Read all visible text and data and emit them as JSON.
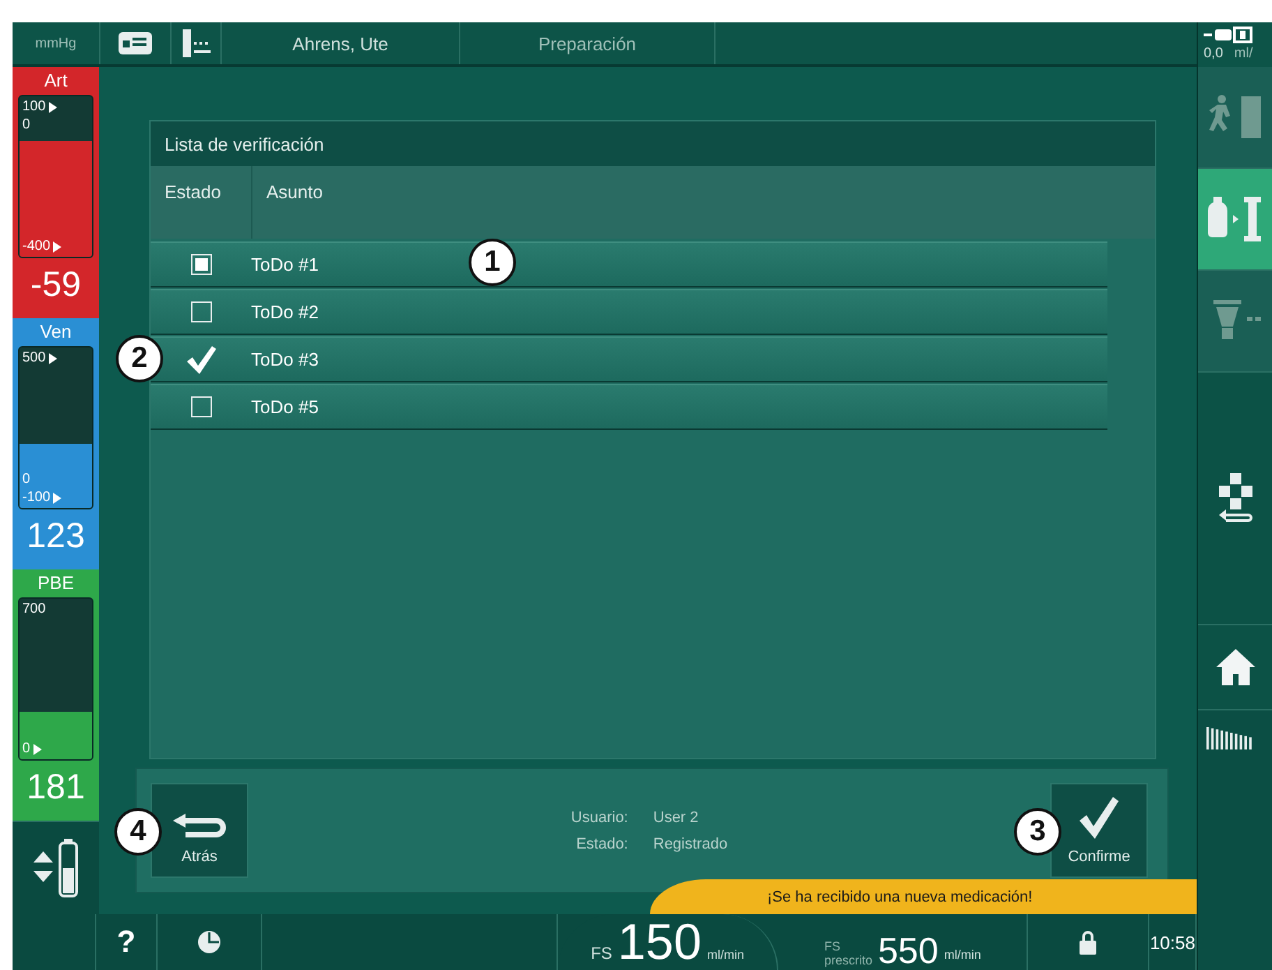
{
  "header": {
    "unit": "mmHg",
    "patient": "Ahrens, Ute",
    "phase": "Preparación",
    "syringe_rate": "0,0",
    "syringe_unit": "ml/"
  },
  "gauges": [
    {
      "label": "Art",
      "color": "#d3262a",
      "top_labels": [
        {
          "label": "100",
          "marker": true
        },
        {
          "label": "0",
          "marker": false
        }
      ],
      "bottom_labels": [
        {
          "label": "-400",
          "marker": true
        }
      ],
      "level": 0.72,
      "value": "-59"
    },
    {
      "label": "Ven",
      "color": "#2a8fd4",
      "top_labels": [
        {
          "label": "500",
          "marker": true
        }
      ],
      "bottom_labels": [
        {
          "label": "0",
          "marker": false
        },
        {
          "label": "-100",
          "marker": true
        }
      ],
      "level": 0.4,
      "value": "123"
    },
    {
      "label": "PBE",
      "color": "#2ea84a",
      "top_labels": [
        {
          "label": "700",
          "marker": false
        }
      ],
      "bottom_labels": [
        {
          "label": "0",
          "marker": true
        }
      ],
      "level": 0.3,
      "value": "181"
    }
  ],
  "checklist": {
    "title": "Lista de verificación",
    "columns": [
      "Estado",
      "Asunto"
    ],
    "items": [
      {
        "label": "ToDo #1",
        "kind": "active",
        "callout": "1"
      },
      {
        "label": "ToDo #2",
        "kind": "open"
      },
      {
        "label": "ToDo #3",
        "kind": "done",
        "callout": "2"
      },
      {
        "label": "ToDo #5",
        "kind": "open"
      }
    ]
  },
  "footer": {
    "back": {
      "label": "Atrás",
      "callout": "4"
    },
    "confirm": {
      "label": "Confirme",
      "callout": "3"
    },
    "info": [
      {
        "label": "Usuario:",
        "value": "User 2"
      },
      {
        "label": "Estado:",
        "value": "Registrado"
      }
    ]
  },
  "banner": "¡Se ha recibido una nueva medicación!",
  "sidebar": [
    {
      "kind": "walker",
      "selected": false,
      "disabled": true
    },
    {
      "kind": "bag-filter",
      "selected": true,
      "disabled": false
    },
    {
      "kind": "dialyzer",
      "selected": false,
      "disabled": true
    },
    {
      "kind": "cubes",
      "selected": false,
      "disabled": false
    },
    {
      "kind": "home",
      "selected": false,
      "disabled": false
    }
  ],
  "status_bar": {
    "help": "?",
    "fs": {
      "label": "FS",
      "value": "150",
      "unit": "ml/min"
    },
    "fs_prescribed": {
      "label": "FS",
      "sublabel": "prescrito",
      "value": "550",
      "unit": "ml/min"
    },
    "time": "10:58"
  }
}
